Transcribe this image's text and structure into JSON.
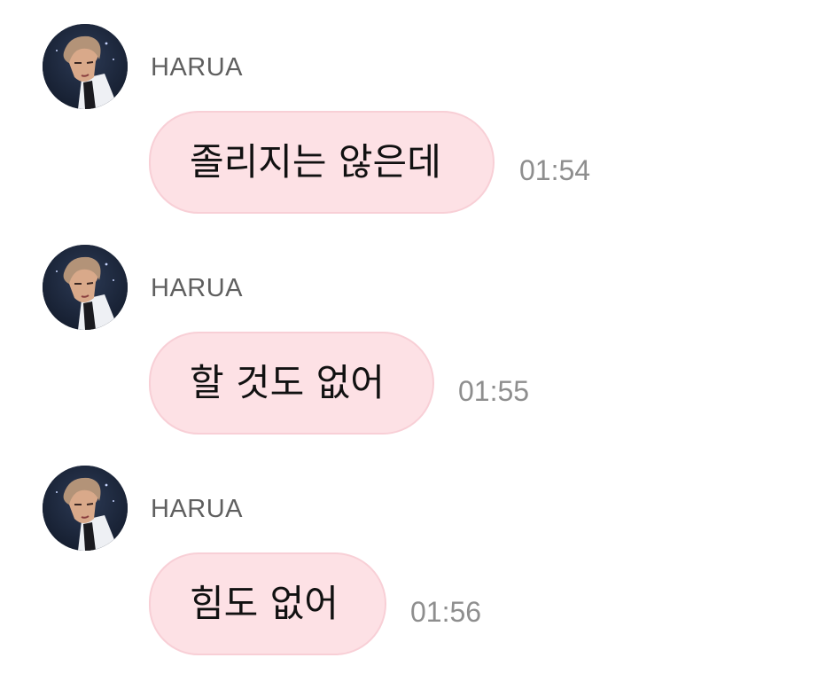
{
  "messages": [
    {
      "sender": "HARUA",
      "text": "졸리지는 않은데",
      "time": "01:54",
      "avatar_icon": "user-avatar-photo"
    },
    {
      "sender": "HARUA",
      "text": "할 것도 없어",
      "time": "01:55",
      "avatar_icon": "user-avatar-photo"
    },
    {
      "sender": "HARUA",
      "text": "힘도 없어",
      "time": "01:56",
      "avatar_icon": "user-avatar-photo"
    }
  ],
  "colors": {
    "background": "#ffffff",
    "bubble_fill": "#fde1e5",
    "bubble_border": "#f8cfd6",
    "sender_text": "#5f5f5f",
    "time_text": "#8e8e8e",
    "message_text": "#111111"
  }
}
